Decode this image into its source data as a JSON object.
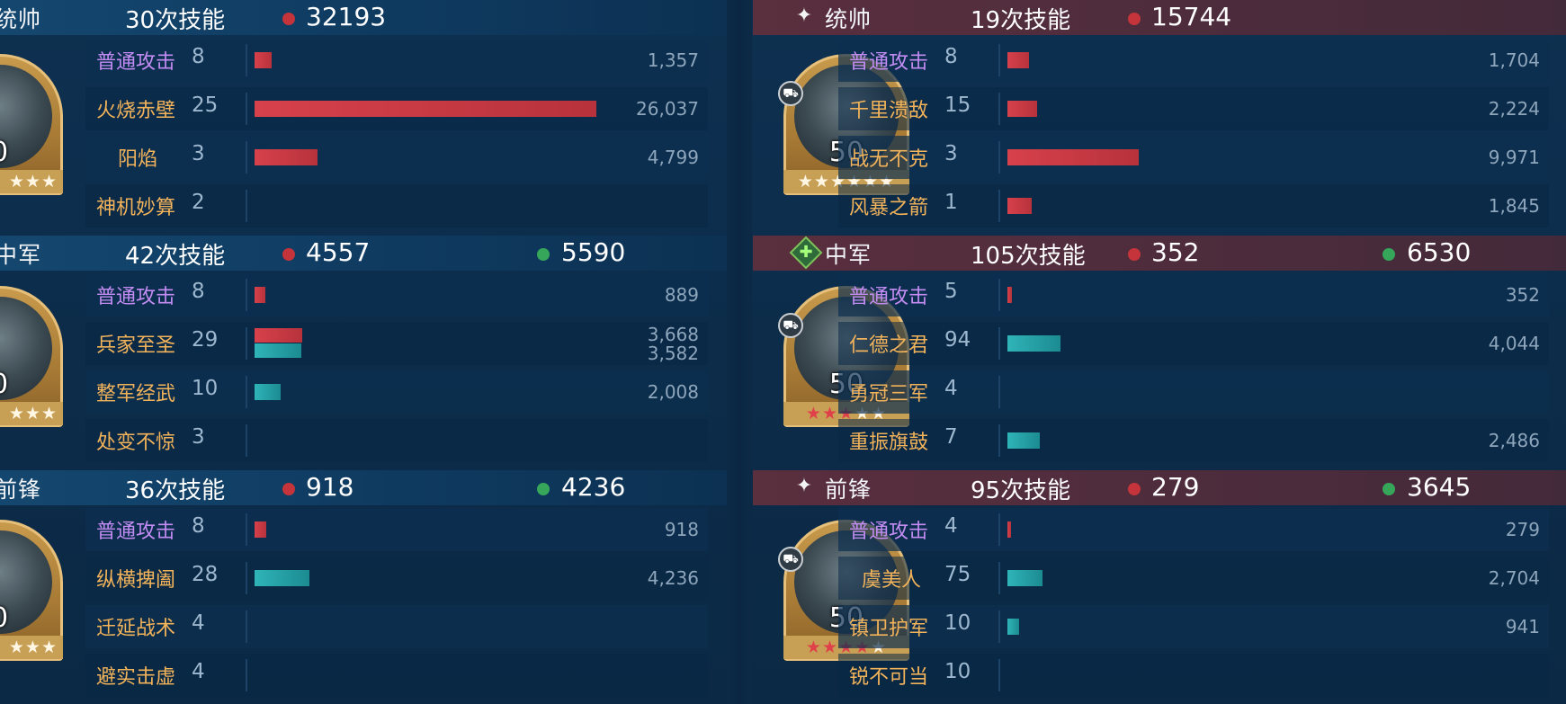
{
  "left": {
    "groups": [
      {
        "role": "统帅",
        "skill_count": "30次技能",
        "damage": "32193",
        "heal": "",
        "portrait": {
          "level": "0",
          "stars": "★★★"
        },
        "rows": [
          {
            "skill": "普通攻击",
            "times": "8",
            "damage_value": "1,357",
            "heal_value": ""
          },
          {
            "skill": "火烧赤壁",
            "times": "25",
            "damage_value": "26,037",
            "heal_value": ""
          },
          {
            "skill": "阳焰",
            "times": "3",
            "damage_value": "4,799",
            "heal_value": ""
          },
          {
            "skill": "神机妙算",
            "times": "2",
            "damage_value": "",
            "heal_value": ""
          }
        ]
      },
      {
        "role": "中军",
        "skill_count": "42次技能",
        "damage": "4557",
        "heal": "5590",
        "portrait": {
          "level": "0",
          "stars": "★★★"
        },
        "rows": [
          {
            "skill": "普通攻击",
            "times": "8",
            "damage_value": "889",
            "heal_value": ""
          },
          {
            "skill": "兵家至圣",
            "times": "29",
            "damage_value": "3,668",
            "heal_value": "3,582"
          },
          {
            "skill": "整军经武",
            "times": "10",
            "damage_value": "",
            "heal_value": "2,008"
          },
          {
            "skill": "处变不惊",
            "times": "3",
            "damage_value": "",
            "heal_value": ""
          }
        ]
      },
      {
        "role": "前锋",
        "skill_count": "36次技能",
        "damage": "918",
        "heal": "4236",
        "portrait": {
          "level": "0",
          "stars": "★★★"
        },
        "rows": [
          {
            "skill": "普通攻击",
            "times": "8",
            "damage_value": "918",
            "heal_value": ""
          },
          {
            "skill": "纵横捭阖",
            "times": "28",
            "damage_value": "",
            "heal_value": "4,236"
          },
          {
            "skill": "迁延战术",
            "times": "4",
            "damage_value": "",
            "heal_value": ""
          },
          {
            "skill": "避实击虚",
            "times": "4",
            "damage_value": "",
            "heal_value": ""
          }
        ]
      }
    ]
  },
  "right": {
    "groups": [
      {
        "role": "统帅",
        "role_icon": "sparkle-icon",
        "skill_count": "19次技能",
        "damage": "15744",
        "heal": "",
        "portrait": {
          "level": "50",
          "stars_white": "★★★★★★",
          "stars_red": "",
          "type_icon": "tank-icon"
        },
        "rows": [
          {
            "skill": "普通攻击",
            "times": "8",
            "damage_value": "1,704",
            "heal_value": ""
          },
          {
            "skill": "千里溃敌",
            "times": "15",
            "damage_value": "2,224",
            "heal_value": ""
          },
          {
            "skill": "战无不克",
            "times": "3",
            "damage_value": "9,971",
            "heal_value": ""
          },
          {
            "skill": "风暴之箭",
            "times": "1",
            "damage_value": "1,845",
            "heal_value": ""
          }
        ]
      },
      {
        "role": "中军",
        "role_icon": "heal-cross-icon",
        "skill_count": "105次技能",
        "damage": "352",
        "heal": "6530",
        "portrait": {
          "level": "50",
          "stars_white": "★★",
          "stars_red": "★★★",
          "type_icon": "tank-icon"
        },
        "rows": [
          {
            "skill": "普通攻击",
            "times": "5",
            "damage_value": "352",
            "heal_value": ""
          },
          {
            "skill": "仁德之君",
            "times": "94",
            "damage_value": "",
            "heal_value": "4,044"
          },
          {
            "skill": "勇冠三军",
            "times": "4",
            "damage_value": "",
            "heal_value": ""
          },
          {
            "skill": "重振旗鼓",
            "times": "7",
            "damage_value": "",
            "heal_value": "2,486"
          }
        ]
      },
      {
        "role": "前锋",
        "role_icon": "sparkle-icon",
        "skill_count": "95次技能",
        "damage": "279",
        "heal": "3645",
        "portrait": {
          "level": "50",
          "stars_white": "★",
          "stars_red": "★★★★",
          "type_icon": "tank-icon"
        },
        "rows": [
          {
            "skill": "普通攻击",
            "times": "4",
            "damage_value": "279",
            "heal_value": ""
          },
          {
            "skill": "虞美人",
            "times": "75",
            "damage_value": "",
            "heal_value": "2,704"
          },
          {
            "skill": "镇卫护军",
            "times": "10",
            "damage_value": "",
            "heal_value": "941"
          },
          {
            "skill": "锐不可当",
            "times": "10",
            "damage_value": "",
            "heal_value": ""
          }
        ]
      }
    ]
  },
  "colors": {
    "damage_red": "#c4343a",
    "heal_green": "#35a65a",
    "attack_purple": "#c28cf2",
    "skill_gold": "#f2b35a"
  }
}
